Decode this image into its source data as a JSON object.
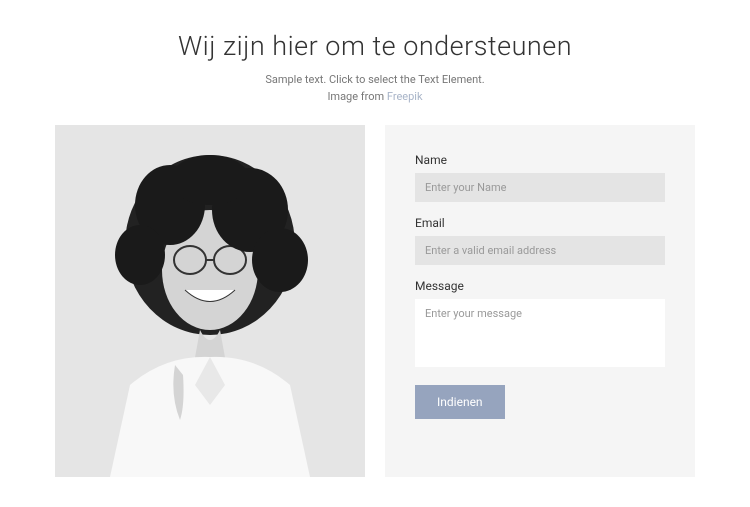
{
  "header": {
    "title": "Wij zijn hier om te ondersteunen",
    "subtitle_line1": "Sample text. Click to select the Text Element.",
    "subtitle_line2_prefix": "Image from ",
    "subtitle_link": "Freepik"
  },
  "form": {
    "name_label": "Name",
    "name_placeholder": "Enter your Name",
    "email_label": "Email",
    "email_placeholder": "Enter a valid email address",
    "message_label": "Message",
    "message_placeholder": "Enter your message",
    "submit_label": "Indienen"
  }
}
